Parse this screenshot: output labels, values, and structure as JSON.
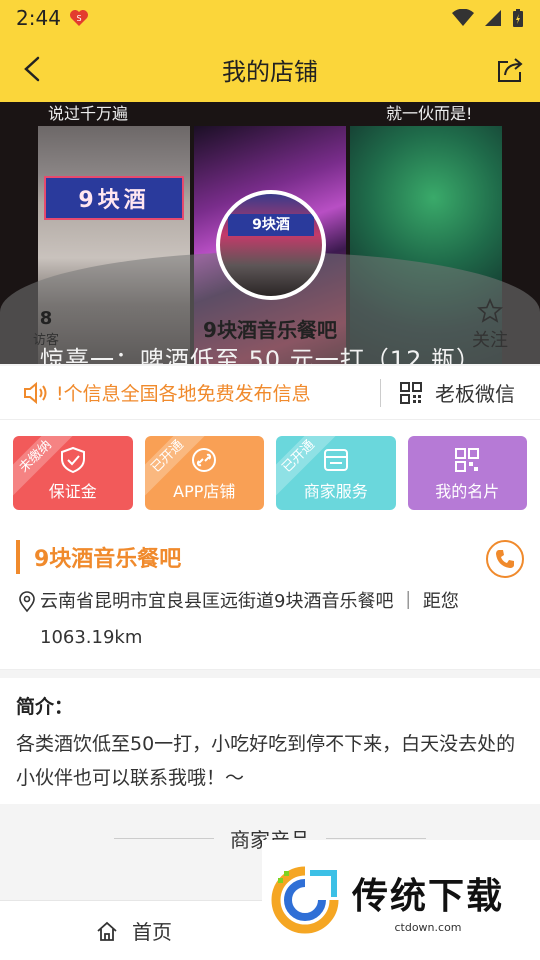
{
  "status": {
    "time": "2:44"
  },
  "header": {
    "title": "我的店铺"
  },
  "hero": {
    "caption_left": "说过千万遍",
    "caption_right": "就一伙而是!",
    "sign_text": "9块酒",
    "avatar_sign": "9块酒",
    "shop_name": "9块酒音乐餐吧",
    "visitor_count": "8",
    "visitor_label": "访客",
    "follow_label": "关注",
    "promo_text": "惊喜一：啤酒低至 50 元一打（12 瓶）"
  },
  "notice": {
    "text": "!个信息全国各地免费发布信息",
    "wechat_label": "老板微信"
  },
  "tiles": [
    {
      "label": "保证金",
      "badge": "未缴纳"
    },
    {
      "label": "APP店铺",
      "badge": "已开通"
    },
    {
      "label": "商家服务",
      "badge": "已开通"
    },
    {
      "label": "我的名片",
      "badge": ""
    }
  ],
  "info": {
    "shop_name": "9块酒音乐餐吧",
    "address": "云南省昆明市宜良县匡远街道9块酒音乐餐吧 ｜ 距您1063.19km"
  },
  "intro": {
    "title": "简介：",
    "text": "各类酒饮低至50一打，小吃好吃到停不下来，白天没去处的小伙伴也可以联系我哦！～"
  },
  "section": {
    "products_heading": "商家产品"
  },
  "bottom_tab": {
    "home_label": "首页"
  },
  "watermark": {
    "title": "传统下载",
    "subtitle": "ctdown.com"
  },
  "colors": {
    "brand_yellow": "#fbd63a",
    "accent_orange": "#f08a2c"
  }
}
